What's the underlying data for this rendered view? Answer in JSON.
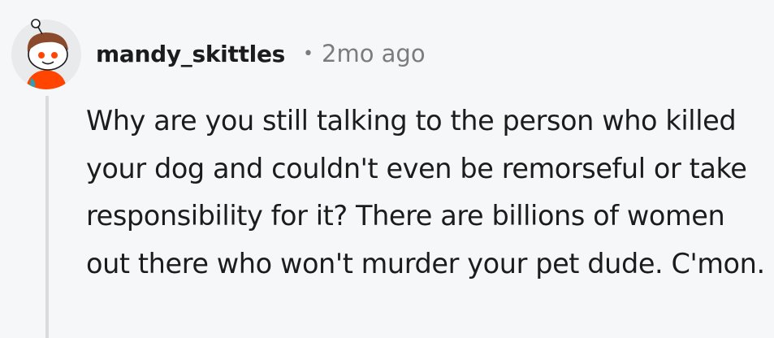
{
  "comment": {
    "author": "mandy_skittles",
    "separator": "•",
    "timestamp": "2mo ago",
    "avatar_icon": "reddit-snoo-avatar-icon",
    "body": "Why are you still talking to the person who killed your dog and couldn't even be remorseful or take responsibility for it? There are billions of women out there who won't murder your pet dude. C'mon."
  },
  "colors": {
    "background": "#f6f7f8",
    "text": "#1c1c1c",
    "meta": "#7c7c7c",
    "thread_line": "#d9dcdf"
  }
}
